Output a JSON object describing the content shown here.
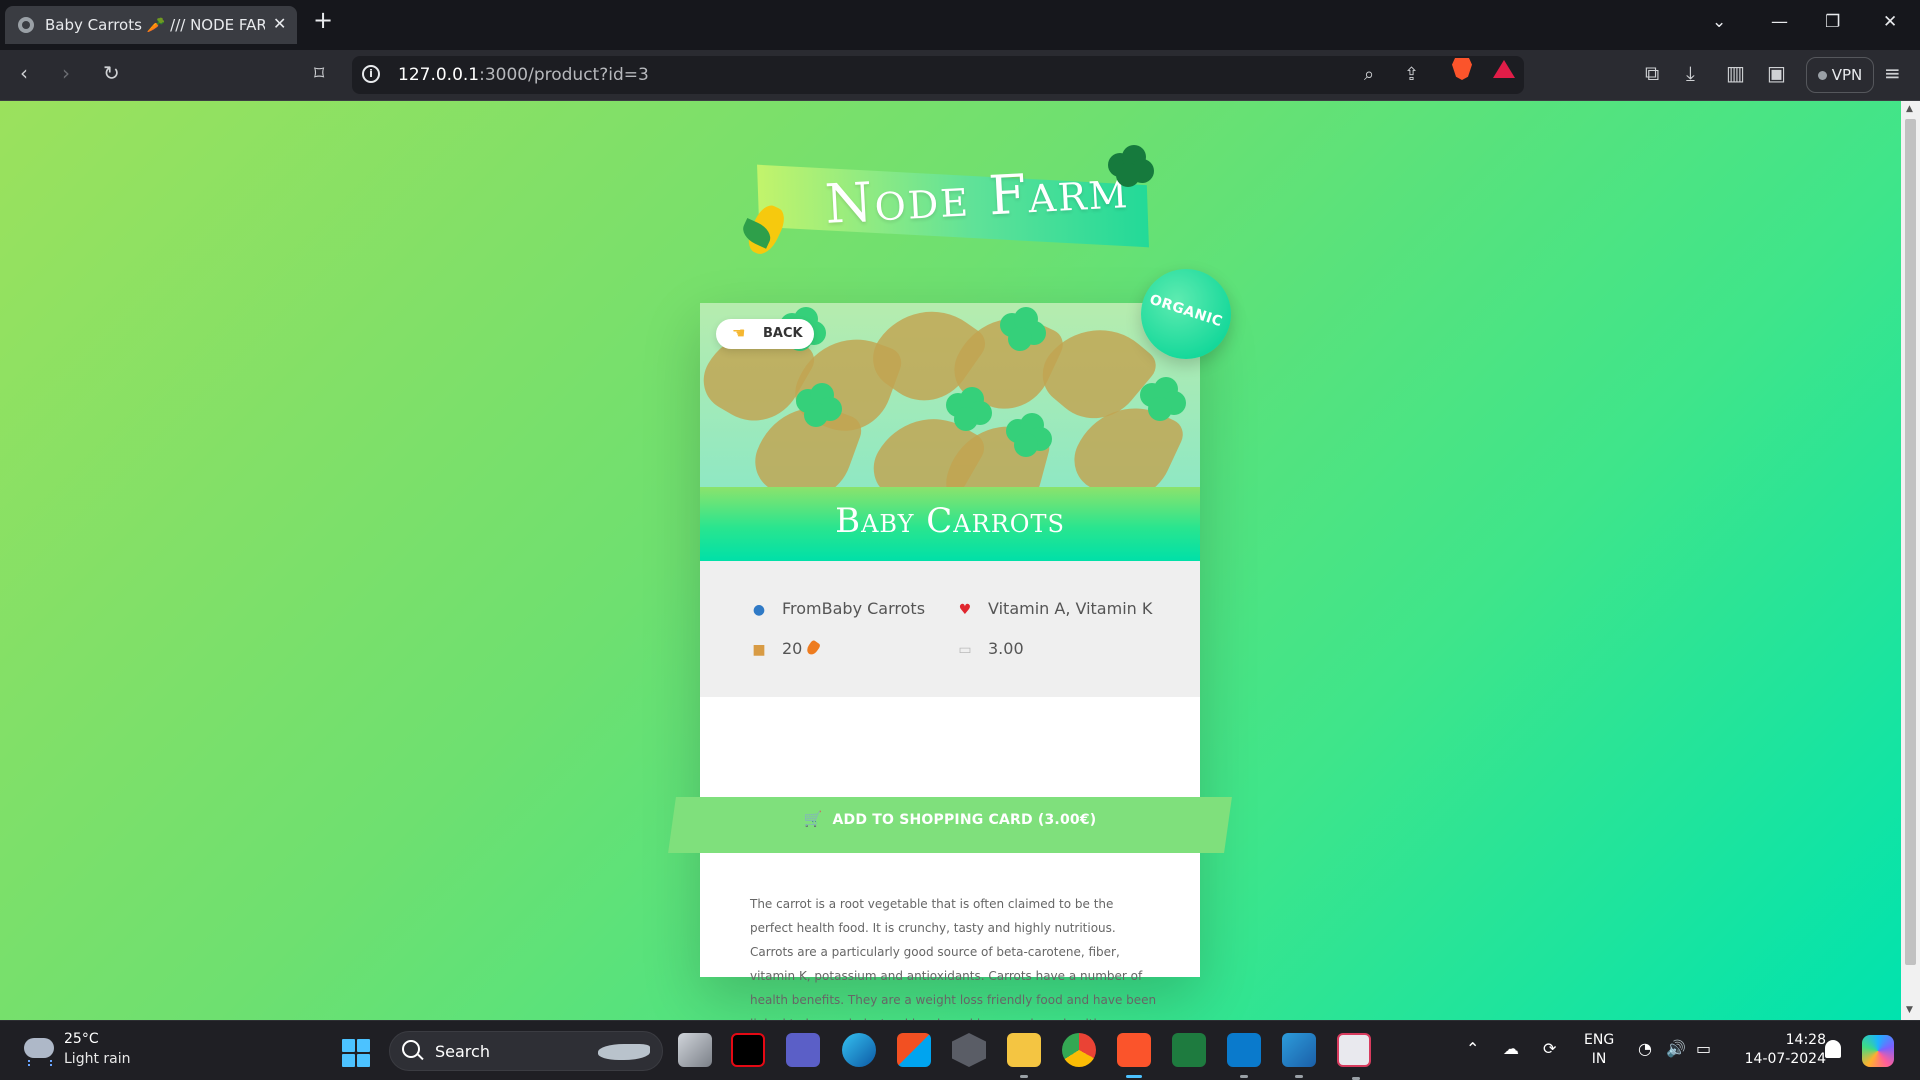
{
  "browser": {
    "tab_title": "Baby Carrots 🥕 /// NODE FARM",
    "url_host": "127.0.0.1",
    "url_path": ":3000/product?id=3",
    "vpn_label": "VPN"
  },
  "page": {
    "logo_text": "Node Farm",
    "back_label": "BACK",
    "badge_label": "ORGANIC",
    "product": {
      "name": "Baby Carrots",
      "from": "FromBaby Carrots",
      "nutrients": "Vitamin A, Vitamin K",
      "quantity": "20",
      "price": "3.00",
      "cart_label": "ADD TO SHOPPING CARD (3.00€)",
      "description": "The carrot is a root vegetable that is often claimed to be the perfect health food. It is crunchy, tasty and highly nutritious. Carrots are a particularly good source of beta-carotene, fiber, vitamin K, potassium and antioxidants. Carrots have a number of health benefits. They are a weight loss friendly food and have been linked to lower cholesterol levels and improved eye health."
    },
    "colors": {
      "gradient_start": "#9be15d",
      "gradient_end": "#00e3ae",
      "cart_band": "#7fe07c"
    }
  },
  "taskbar": {
    "temperature": "25°C",
    "weather": "Light rain",
    "search_label": "Search",
    "lang_top": "ENG",
    "lang_bottom": "IN",
    "time": "14:28",
    "date": "14-07-2024"
  }
}
